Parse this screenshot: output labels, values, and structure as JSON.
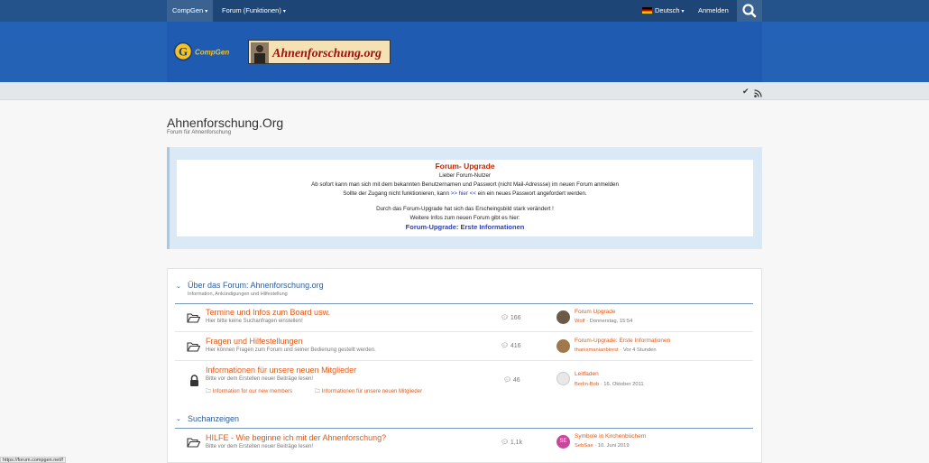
{
  "topnav": {
    "menu_compgen": "CompGen",
    "menu_forum": "Forum (Funktionen)",
    "language": "Deutsch",
    "login": "Anmelden",
    "search_icon": "search-icon"
  },
  "banner": {
    "logo_compgen_text": "CompGen",
    "logo_forum_text": "Ahnenforschung.org"
  },
  "subbar": {
    "icons": [
      "check-icon",
      "rss-icon"
    ]
  },
  "page": {
    "title": "Ahnenforschung.Org",
    "subtitle": "Forum für Ahnenforschung"
  },
  "notice": {
    "heading": "Forum- Upgrade",
    "line1": "Lieber Forum-Nutzer",
    "line2": "Ab sofort kann man sich mit dem bekannten Benutzernamen und Passwort (nicht Mail-Adressse) im neuen Forum anmelden",
    "line3_pre": "Sollte der Zugang nicht funktionieren, kann",
    "line3_link": ">> hier <<",
    "line3_post": "ein ein neues Passwort angefordert werden.",
    "line4": "Durch das Forum-Upgrade hat sich das Erscheingsbild stark verändert !",
    "line5": "Weitere Infos zum neuen Forum gibt es hier:",
    "link_bold": "Forum-Upgrade: Erste Informationen"
  },
  "categories": [
    {
      "title": "Über das Forum: Ahnenforschung.org",
      "desc": "Information, Ankündigungen und Hilfestellung"
    },
    {
      "title": "Suchanzeigen",
      "desc": ""
    }
  ],
  "nodes": [
    {
      "title": "Termine und Infos zum Board usw.",
      "desc": "Hier bitte keine Suchanfragen einstellen!",
      "count": "166",
      "last_title": "Forum Upgrade",
      "last_user": "Wolf",
      "last_time": "Donnerstag, 15:54"
    },
    {
      "title": "Fragen und Hilfestellungen",
      "desc": "Hier können Fragen zum Forum und seiner Bedienung gestellt werden.",
      "count": "416",
      "last_title": "Forum-Upgrade: Erste Informationen",
      "last_user": "thanismanianbirest",
      "last_time": "Vor 4 Stunden"
    },
    {
      "title": "Informationen für unsere neuen Mitglieder",
      "desc": "Bitte vor dem Erstellen neuer Beiträge lesen!",
      "count": "46",
      "last_title": "Leitfaden",
      "last_user": "Berlin-Bob",
      "last_time": "16. Oktober 2011",
      "subforums": [
        "Information for our new members",
        "Informationen für unsere neuen Mitglieder"
      ]
    },
    {
      "title": "HILFE - Wie beginne ich mit der Ahnenforschung?",
      "desc": "Bitte vor dem Erstellen neuer Beiträge lesen!",
      "count": "1,1k",
      "last_title": "Symbole in Kirchenbüchern",
      "last_user": "SebSae",
      "last_time": "10. Juni 2019",
      "avatar_initials": "SE"
    }
  ],
  "status_url": "https://forum.compgen.net/f"
}
